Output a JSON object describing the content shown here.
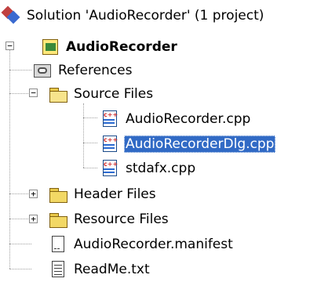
{
  "tree": {
    "solution_label": "Solution 'AudioRecorder' (1 project)",
    "project": {
      "label": "AudioRecorder",
      "expanded": true,
      "children": [
        {
          "label": "References",
          "icon": "references-icon"
        },
        {
          "label": "Source Files",
          "icon": "folder-open-icon",
          "expanded": true,
          "children": [
            {
              "label": "AudioRecorder.cpp",
              "icon": "cpp-file-icon"
            },
            {
              "label": "AudioRecorderDlg.cpp",
              "icon": "cpp-file-icon",
              "selected": true
            },
            {
              "label": "stdafx.cpp",
              "icon": "cpp-file-icon"
            }
          ]
        },
        {
          "label": "Header Files",
          "icon": "folder-icon",
          "expanded": false
        },
        {
          "label": "Resource Files",
          "icon": "folder-icon",
          "expanded": false
        },
        {
          "label": "AudioRecorder.manifest",
          "icon": "manifest-file-icon"
        },
        {
          "label": "ReadMe.txt",
          "icon": "text-file-icon"
        }
      ]
    },
    "expander_symbols": {
      "expanded": "−",
      "collapsed": "+"
    },
    "colors": {
      "selection": "#316ac5",
      "tree_lines": "#a0a0a0"
    }
  }
}
